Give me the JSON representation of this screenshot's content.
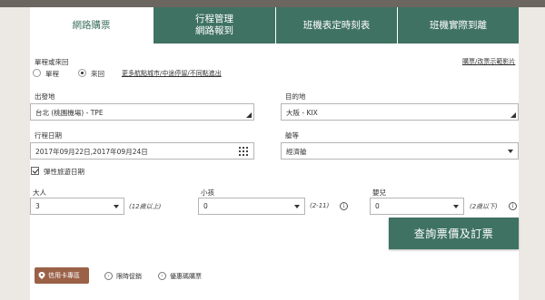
{
  "tabs": [
    {
      "label": "網路購票",
      "active": true
    },
    {
      "line1": "行程管理",
      "line2": "網路報到"
    },
    {
      "label": "班機表定時刻表"
    },
    {
      "label": "班機實際到離"
    }
  ],
  "trip_type": {
    "label": "單程或來回",
    "option_oneway": "單程",
    "option_roundtrip": "來回",
    "selected": "來回",
    "multi_city_link": "更多航點城市/中途停留/不同點進出"
  },
  "demo_link": "購票/改票示範影片",
  "origin": {
    "label": "出發地",
    "value": "台北 (桃園機場) - TPE"
  },
  "destination": {
    "label": "目的地",
    "value": "大阪 - KIX"
  },
  "dates": {
    "label": "行程日期",
    "value": "2017年09月22日,2017年09月24日"
  },
  "cabin": {
    "label": "艙等",
    "value": "經濟艙"
  },
  "flexible": {
    "label": "彈性旅遊日期",
    "checked": true
  },
  "adults": {
    "label": "大人",
    "value": "3",
    "hint": "(12歲以上)"
  },
  "children": {
    "label": "小孩",
    "value": "0",
    "hint": "(2-11)"
  },
  "infants": {
    "label": "嬰兒",
    "value": "0",
    "hint": "(2歲以下)"
  },
  "search_button": "查詢票價及訂票",
  "promos": {
    "credit_card": "信用卡專區",
    "limited_offer": "限時促銷",
    "coupon": "優惠碼購票"
  },
  "colors": {
    "brand_green": "#3f7263",
    "promo_brown": "#9b6147"
  }
}
